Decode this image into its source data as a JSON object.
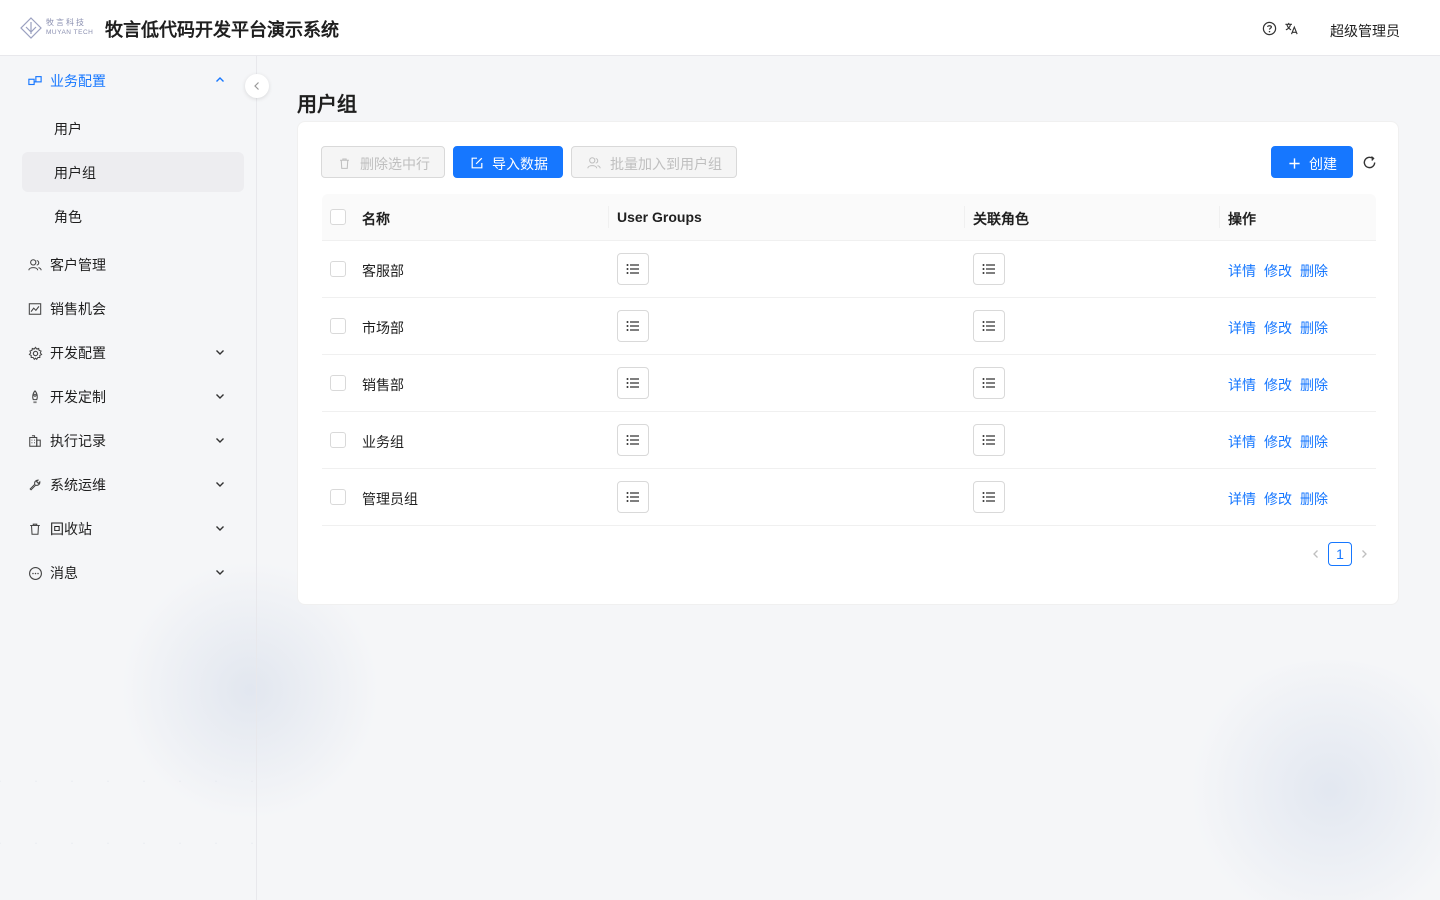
{
  "header": {
    "logo_cn": "牧言科技",
    "logo_en": "MUYAN TECH",
    "title": "牧言低代码开发平台演示系统",
    "user": "超级管理员"
  },
  "sidebar": {
    "groups": [
      {
        "label": "业务配置",
        "icon": "business-config-icon",
        "expanded": true
      },
      {
        "label": "客户管理",
        "icon": "customer-icon"
      },
      {
        "label": "销售机会",
        "icon": "chart-icon"
      },
      {
        "label": "开发配置",
        "icon": "gear-icon"
      },
      {
        "label": "开发定制",
        "icon": "rocket-icon"
      },
      {
        "label": "执行记录",
        "icon": "building-icon"
      },
      {
        "label": "系统运维",
        "icon": "wrench-icon"
      },
      {
        "label": "回收站",
        "icon": "trash-icon"
      },
      {
        "label": "消息",
        "icon": "message-icon"
      }
    ],
    "subitems": [
      {
        "label": "用户"
      },
      {
        "label": "用户组",
        "selected": true
      },
      {
        "label": "角色"
      }
    ]
  },
  "page": {
    "title": "用户组"
  },
  "toolbar": {
    "delete_label": "删除选中行",
    "import_label": "导入数据",
    "batch_label": "批量加入到用户组",
    "create_label": "创建"
  },
  "table": {
    "columns": [
      "名称",
      "User Groups",
      "关联角色",
      "操作"
    ],
    "rows": [
      {
        "name": "客服部"
      },
      {
        "name": "市场部"
      },
      {
        "name": "销售部"
      },
      {
        "name": "业务组"
      },
      {
        "name": "管理员组"
      }
    ],
    "actions": [
      "详情",
      "修改",
      "删除"
    ]
  },
  "pagination": {
    "current": "1"
  },
  "colors": {
    "primary": "#1677ff",
    "selected_bg": "#ededf0"
  }
}
